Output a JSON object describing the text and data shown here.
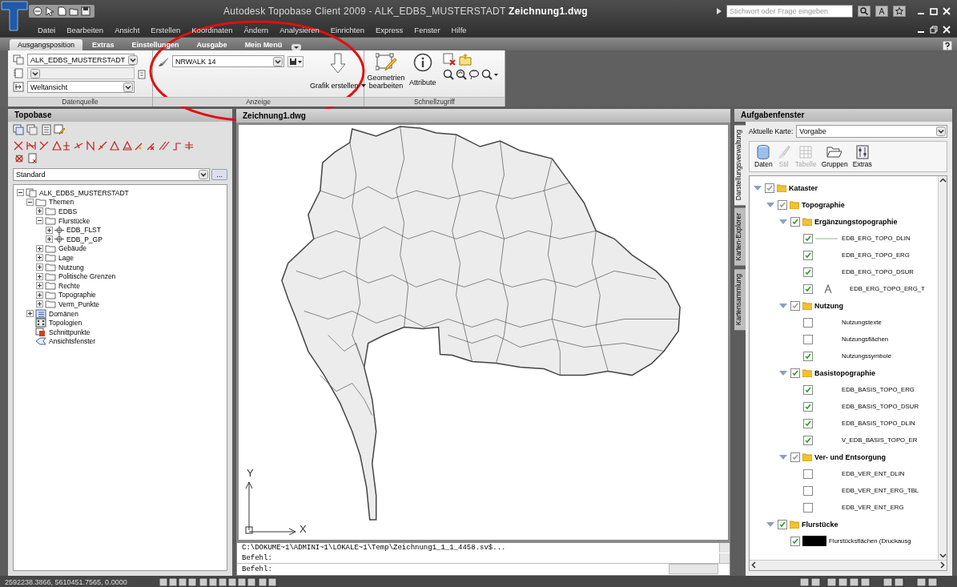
{
  "window": {
    "title": "Autodesk Topobase Client 2009 - ALK_EDBS_MUSTERSTADT **Zeichnung1.dwg**"
  },
  "search": {
    "placeholder": "Stichwort oder Frage eingeben"
  },
  "menu": [
    "Datei",
    "Bearbeiten",
    "Ansicht",
    "Erstellen",
    "Koordinaten",
    "Ändern",
    "Analysieren",
    "Einrichten",
    "Express",
    "Fenster",
    "Hilfe"
  ],
  "ribbon_tabs": [
    {
      "label": "Ausgangsposition",
      "selected": true
    },
    {
      "label": "Extras",
      "selected": false
    },
    {
      "label": "Einstellungen",
      "selected": false
    },
    {
      "label": "Ausgabe",
      "selected": false
    },
    {
      "label": "Mein Menü",
      "selected": false
    }
  ],
  "ribbon": {
    "datenquelle": {
      "title": "Datenquelle",
      "fields": [
        {
          "value": "ALK_EDBS_MUSTERSTADT",
          "disabled": false
        },
        {
          "disabled": true
        },
        {
          "value": "Weltansicht",
          "disabled": false
        }
      ]
    },
    "anzeige": {
      "title": "Anzeige",
      "style": "NRWALK 14",
      "create_button": "Grafik erstellen"
    },
    "schnellzugriff": {
      "title": "Schnellzugriff",
      "edit_button": "Geometrien bearbeiten",
      "attribute_button": "Attribute"
    }
  },
  "topobase": {
    "title": "Topobase",
    "profile": "Standard",
    "more_button": "...",
    "tree": [
      {
        "label": "ALK_EDBS_MUSTERSTADT",
        "kind": "map",
        "expanded": true,
        "children": [
          {
            "label": "Themen",
            "kind": "folder",
            "expanded": true,
            "children": [
              {
                "label": "EDBS",
                "kind": "folder",
                "expanded": false
              },
              {
                "label": "Flurstücke",
                "kind": "folder",
                "expanded": true,
                "children": [
                  {
                    "label": "EDB_FLST",
                    "kind": "feature",
                    "expanded": false
                  },
                  {
                    "label": "EDB_P_GP",
                    "kind": "feature",
                    "expanded": false
                  }
                ]
              },
              {
                "label": "Gebäude",
                "kind": "folder",
                "expanded": false
              },
              {
                "label": "Lage",
                "kind": "folder",
                "expanded": false
              },
              {
                "label": "Nutzung",
                "kind": "folder",
                "expanded": false
              },
              {
                "label": "Politische Grenzen",
                "kind": "folder",
                "expanded": false
              },
              {
                "label": "Rechte",
                "kind": "folder",
                "expanded": false
              },
              {
                "label": "Topographie",
                "kind": "folder",
                "expanded": false
              },
              {
                "label": "Verm_Punkte",
                "kind": "folder",
                "expanded": false
              }
            ]
          },
          {
            "label": "Domänen",
            "kind": "domain",
            "expanded": false
          },
          {
            "label": "Topologien",
            "kind": "topology"
          },
          {
            "label": "Schnittpunkte",
            "kind": "intersection"
          },
          {
            "label": "Ansichtsfenster",
            "kind": "viewport"
          }
        ]
      }
    ]
  },
  "drawing": {
    "tab": "Zeichnung1.dwg",
    "ucs": {
      "y": "Y",
      "x": "X"
    }
  },
  "command": {
    "history": [
      "C:\\DOKUME~1\\ADMINI~1\\LOKALE~1\\Temp\\Zeichnung1_1_1_4458.sv$...",
      "Befehl:"
    ],
    "prompt": "Befehl:"
  },
  "task_pane": {
    "title": "Aufgabenfenster",
    "side_tabs": [
      {
        "label": "Darstellungsverwaltung",
        "selected": true
      },
      {
        "label": "Karten-Explorer",
        "selected": false
      },
      {
        "label": "Kartensammlung",
        "selected": false
      }
    ],
    "map_label": "Aktuelle Karte:",
    "map": "Vorgabe",
    "tools": [
      {
        "label": "Daten",
        "kind": "data",
        "disabled": false
      },
      {
        "label": "Stil",
        "kind": "style",
        "disabled": true
      },
      {
        "label": "Tabelle",
        "kind": "table",
        "disabled": true
      },
      {
        "label": "Gruppen",
        "kind": "groups",
        "disabled": false
      },
      {
        "label": "Extras",
        "kind": "extras",
        "disabled": false
      }
    ],
    "layers": [
      {
        "label": "Kataster",
        "expanded": true,
        "checked": true,
        "disabled": true,
        "children": [
          {
            "label": "Topographie",
            "expanded": true,
            "checked": true,
            "disabled": true,
            "children": [
              {
                "label": "Ergänzungstopographie",
                "expanded": true,
                "checked": true,
                "disabled": false,
                "children": [
                  {
                    "label": "EDB_ERG_TOPO_DLIN",
                    "checked": true,
                    "kind": "line"
                  },
                  {
                    "label": "EDB_ERG_TOPO_ERG",
                    "checked": true,
                    "kind": "none"
                  },
                  {
                    "label": "EDB_ERG_TOPO_DSUR",
                    "checked": true,
                    "kind": "none"
                  },
                  {
                    "label": "EDB_ERG_TOPO_ERG_T",
                    "checked": true,
                    "kind": "text"
                  }
                ]
              },
              {
                "label": "Nutzung",
                "expanded": true,
                "checked": true,
                "disabled": true,
                "children": [
                  {
                    "label": "Nutzungstexte",
                    "checked": false,
                    "kind": "none"
                  },
                  {
                    "label": "Nutzungsflächen",
                    "checked": false,
                    "kind": "none"
                  },
                  {
                    "label": "Nutzungssymbole",
                    "checked": true,
                    "kind": "none"
                  }
                ]
              },
              {
                "label": "Basistopographie",
                "expanded": true,
                "checked": true,
                "disabled": false,
                "children": [
                  {
                    "label": "EDB_BASIS_TOPO_ERG",
                    "checked": true,
                    "kind": "none"
                  },
                  {
                    "label": "EDB_BASIS_TOPO_DSUR",
                    "checked": true,
                    "kind": "none"
                  },
                  {
                    "label": "EDB_BASIS_TOPO_DLIN",
                    "checked": true,
                    "kind": "none"
                  },
                  {
                    "label": "V_EDB_BASIS_TOPO_ER",
                    "checked": true,
                    "kind": "none"
                  }
                ]
              },
              {
                "label": "Ver- und Entsorgung",
                "expanded": true,
                "checked": true,
                "disabled": true,
                "children": [
                  {
                    "label": "EDB_VER_ENT_DLIN",
                    "checked": false,
                    "kind": "none"
                  },
                  {
                    "label": "EDB_VER_ENT_ERG_TBL",
                    "checked": false,
                    "kind": "none"
                  },
                  {
                    "label": "EDB_VER_ENT_ERG",
                    "checked": false,
                    "kind": "none"
                  }
                ]
              }
            ]
          },
          {
            "label": "Flurstücke",
            "expanded": true,
            "checked": true,
            "disabled": false,
            "children": [
              {
                "label": "Flurstücksflächen (Druckausg",
                "checked": true,
                "kind": "swatch"
              }
            ]
          }
        ]
      }
    ]
  },
  "status_bar": {
    "coordinates": "2592238.3866, 5610451.7565, 0.0000"
  }
}
